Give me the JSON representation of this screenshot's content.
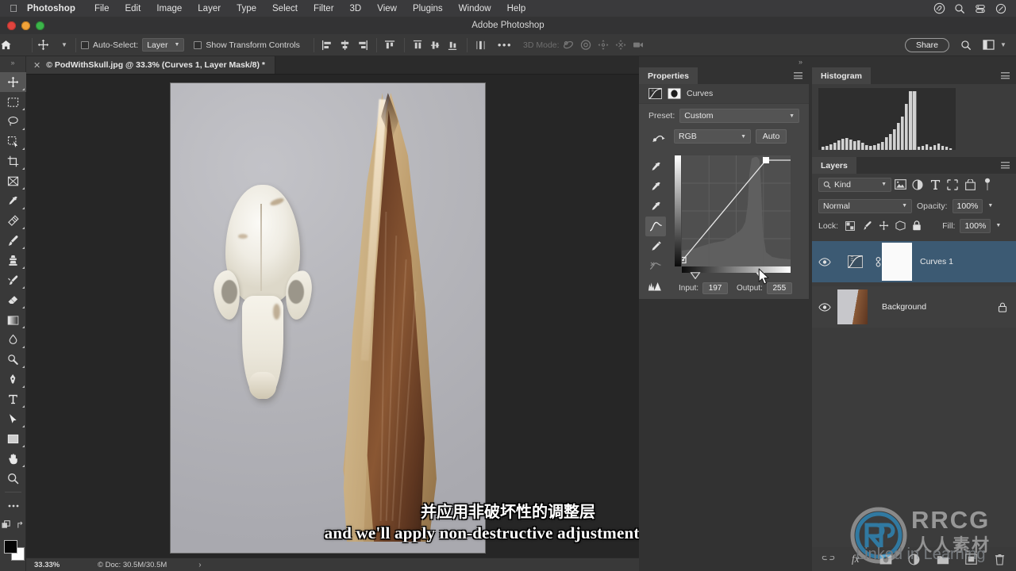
{
  "menubar": {
    "apple_icon": "apple-logo-icon",
    "app_name": "Photoshop",
    "items": [
      "File",
      "Edit",
      "Image",
      "Layer",
      "Type",
      "Select",
      "Filter",
      "3D",
      "View",
      "Plugins",
      "Window",
      "Help"
    ],
    "status_icons": [
      "creative-cloud-icon",
      "spotlight-search-icon",
      "control-center-icon",
      "siri-icon"
    ]
  },
  "window": {
    "title": "Adobe Photoshop",
    "traffic_lights": [
      "close-button",
      "minimize-button",
      "zoom-button"
    ]
  },
  "options_bar": {
    "home_icon": "home-icon",
    "tool_icon": "move-tool-icon",
    "auto_select_label": "Auto-Select:",
    "auto_select_value": "Layer",
    "show_transform_label": "Show Transform Controls",
    "mode_3d_label": "3D Mode:",
    "more_label": "•••",
    "share_label": "Share",
    "search_icon": "search-icon",
    "workspace_icon": "workspace-icon"
  },
  "toolbar": {
    "collapse_icon": "double-chevron-right-icon",
    "tools": [
      {
        "name": "move-tool",
        "selected": true
      },
      {
        "name": "rectangular-marquee-tool",
        "selected": false
      },
      {
        "name": "lasso-tool",
        "selected": false
      },
      {
        "name": "object-selection-tool",
        "selected": false
      },
      {
        "name": "crop-tool",
        "selected": false
      },
      {
        "name": "frame-tool",
        "selected": false
      },
      {
        "name": "eyedropper-tool",
        "selected": false
      },
      {
        "name": "spot-healing-brush-tool",
        "selected": false
      },
      {
        "name": "brush-tool",
        "selected": false
      },
      {
        "name": "clone-stamp-tool",
        "selected": false
      },
      {
        "name": "history-brush-tool",
        "selected": false
      },
      {
        "name": "eraser-tool",
        "selected": false
      },
      {
        "name": "gradient-tool",
        "selected": false
      },
      {
        "name": "blur-tool",
        "selected": false
      },
      {
        "name": "dodge-tool",
        "selected": false
      },
      {
        "name": "pen-tool",
        "selected": false
      },
      {
        "name": "horizontal-type-tool",
        "selected": false
      },
      {
        "name": "path-selection-tool",
        "selected": false
      },
      {
        "name": "rectangle-tool",
        "selected": false
      },
      {
        "name": "hand-tool",
        "selected": false
      },
      {
        "name": "zoom-tool",
        "selected": false
      },
      {
        "name": "edit-toolbar-tool",
        "selected": false
      }
    ],
    "quick_mask_icon": "quick-mask-icon",
    "screen_mode_icon": "screen-mode-icon",
    "foreground_color": "#050505",
    "background_color": "#fdfdfd"
  },
  "document": {
    "tab_title": "© PodWithSkull.jpg @ 33.3% (Curves 1, Layer Mask/8) *",
    "close_icon": "close-icon"
  },
  "statusbar": {
    "zoom": "33.33%",
    "doc_info": "Doc: 30.5M/30.5M",
    "arrow_icon": "chevron-right-icon"
  },
  "properties": {
    "tab_label": "Properties",
    "menu_icon": "panel-menu-icon",
    "adjustment_icon": "curves-adjustment-icon",
    "mask_icon": "layer-mask-icon",
    "title": "Curves",
    "preset_label": "Preset:",
    "preset_value": "Custom",
    "channel_value": "RGB",
    "auto_label": "Auto",
    "on_image_icon": "on-image-adjustment-icon",
    "tools": [
      {
        "name": "set-black-point-eyedropper-icon",
        "selected": false
      },
      {
        "name": "set-gray-point-eyedropper-icon",
        "selected": false
      },
      {
        "name": "set-white-point-eyedropper-icon",
        "selected": false
      },
      {
        "name": "curve-point-tool-icon",
        "selected": true
      },
      {
        "name": "pencil-draw-curve-icon",
        "selected": false
      },
      {
        "name": "smooth-curve-icon",
        "selected": false
      },
      {
        "name": "histogram-display-options-icon",
        "selected": false
      }
    ],
    "input_label": "Input:",
    "input_value": "197",
    "output_label": "Output:",
    "output_value": "255",
    "cursor_icon": "cursor-arrow-icon"
  },
  "histogram": {
    "tab_label": "Histogram",
    "menu_icon": "panel-menu-icon",
    "warning_icon": "cached-data-warning-icon"
  },
  "layers": {
    "tab_label": "Layers",
    "menu_icon": "panel-menu-icon",
    "filter_kind_label": "Kind",
    "filter_search_icon": "search-icon",
    "filter_icons": [
      "filter-pixel-layers-icon",
      "filter-adjustment-layers-icon",
      "filter-type-layers-icon",
      "filter-shape-layers-icon",
      "filter-smart-objects-icon",
      "filter-toggle-icon"
    ],
    "blend_mode": "Normal",
    "opacity_label": "Opacity:",
    "opacity_value": "100%",
    "lock_label": "Lock:",
    "lock_icons": [
      "lock-transparent-pixels-icon",
      "lock-image-pixels-icon",
      "lock-position-icon",
      "lock-artboard-nesting-icon",
      "lock-all-icon"
    ],
    "fill_label": "Fill:",
    "fill_value": "100%",
    "rows": [
      {
        "name": "Curves 1",
        "visible": true,
        "selected": true,
        "eye_icon": "eye-icon",
        "thumb": "curves-adjustment-thumb",
        "link_icon": "link-mask-icon",
        "mask_thumb": "white-layer-mask-thumb",
        "locked": false
      },
      {
        "name": "Background",
        "visible": true,
        "selected": false,
        "eye_icon": "eye-icon",
        "thumb": "background-image-thumb",
        "locked": true,
        "lock_icon": "lock-icon"
      }
    ],
    "bottom_icons": [
      "link-layers-icon",
      "add-layer-style-icon",
      "add-layer-mask-icon",
      "new-adjustment-layer-icon",
      "new-group-icon",
      "new-layer-icon",
      "delete-layer-icon"
    ]
  },
  "subtitles": {
    "chinese": "并应用非破坏性的调整层",
    "english": "and we'll apply non-destructive adjustment layers."
  },
  "watermark": {
    "brand": "RRCG",
    "brand_cn": "人人素材",
    "secondary": "Linked in Learning"
  },
  "colors": {
    "menubar_bg": "#3a3a3c",
    "panel_bg": "#3c3c3c",
    "properties_bg": "#454545",
    "canvas_bg": "#262626",
    "layer_selected": "#3c5a73",
    "text": "#e6e6e6"
  }
}
